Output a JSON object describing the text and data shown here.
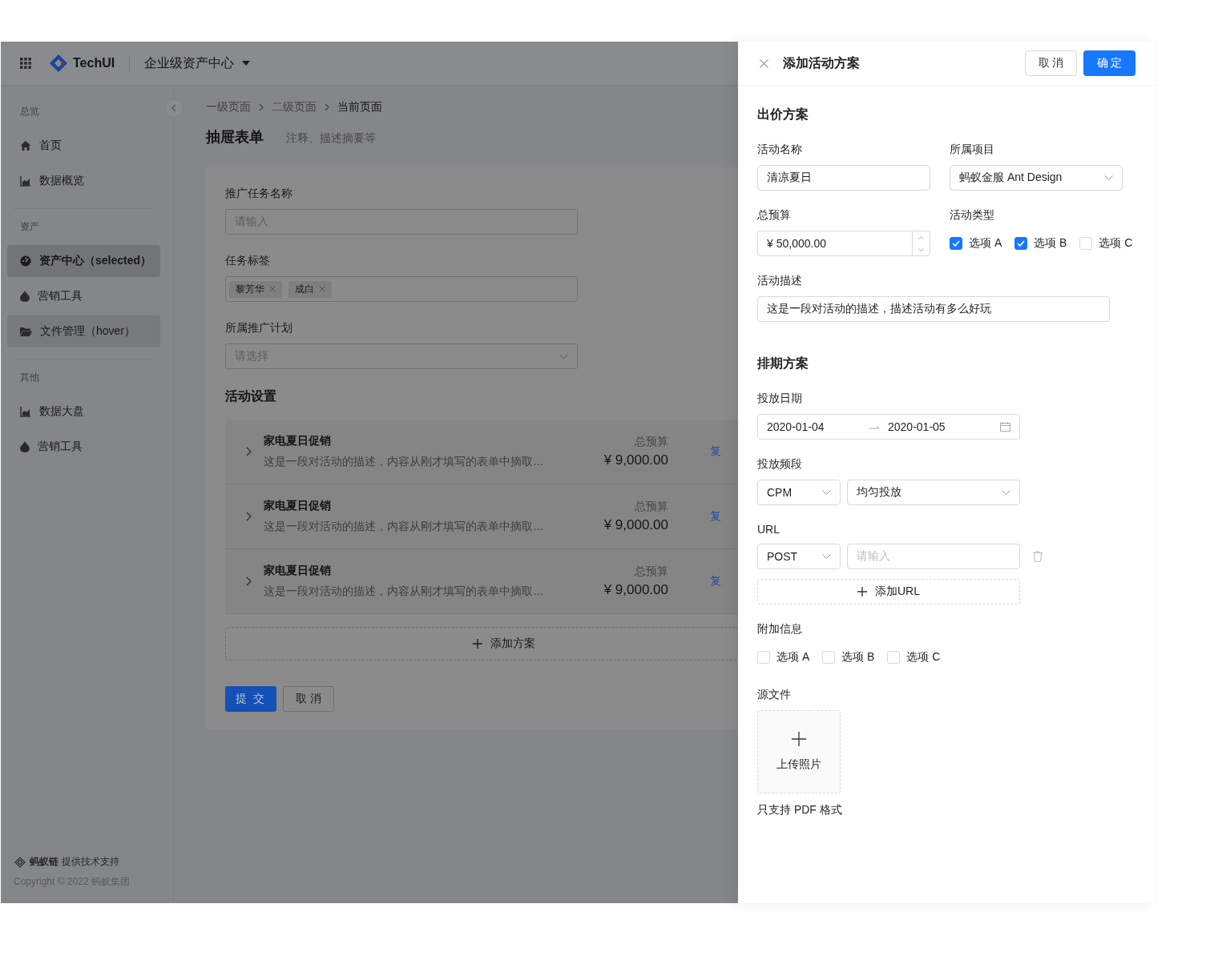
{
  "header": {
    "brand": "TechUI",
    "app_switch": "企业级资产中心"
  },
  "sidebar": {
    "groups": [
      {
        "title": "总览",
        "items": [
          {
            "label": "首页",
            "selected": false,
            "hovered": false
          },
          {
            "label": "数据概览",
            "selected": false,
            "hovered": false
          }
        ]
      },
      {
        "title": "资产",
        "items": [
          {
            "label": "资产中心（selected）",
            "selected": true,
            "hovered": false
          },
          {
            "label": "营销工具",
            "selected": false,
            "hovered": false
          },
          {
            "label": "文件管理（hover）",
            "selected": false,
            "hovered": true
          }
        ]
      },
      {
        "title": "其他",
        "items": [
          {
            "label": "数据大盘",
            "selected": false,
            "hovered": false
          },
          {
            "label": "营销工具",
            "selected": false,
            "hovered": false
          }
        ]
      }
    ],
    "footer": {
      "support_brand": "蚂蚁链",
      "support_text": "提供技术支持",
      "copyright": "Copyright © 2022 蚂蚁集团"
    }
  },
  "breadcrumb": [
    {
      "label": "一级页面",
      "current": false
    },
    {
      "label": "二级页面",
      "current": false
    },
    {
      "label": "当前页面",
      "current": true
    }
  ],
  "page": {
    "title": "抽屉表单",
    "subtitle": "注释、描述摘要等"
  },
  "form": {
    "fields": [
      {
        "kind": "input",
        "label": "推广任务名称",
        "placeholder": "请输入"
      },
      {
        "kind": "tags",
        "label": "任务标签",
        "tags": [
          "黎芳华",
          "成白"
        ]
      },
      {
        "kind": "select",
        "label": "所属推广计划",
        "placeholder": "请选择"
      }
    ],
    "section_title": "活动设置",
    "plans": [
      {
        "title": "家电夏日促销",
        "description": "这是一段对活动的描述，内容从刚才填写的表单中摘取…",
        "budget_label": "总预算",
        "budget": "¥ 9,000.00",
        "action": "复"
      },
      {
        "title": "家电夏日促销",
        "description": "这是一段对活动的描述，内容从刚才填写的表单中摘取…",
        "budget_label": "总预算",
        "budget": "¥ 9,000.00",
        "action": "复"
      },
      {
        "title": "家电夏日促销",
        "description": "这是一段对活动的描述，内容从刚才填写的表单中摘取…",
        "budget_label": "总预算",
        "budget": "¥ 9,000.00",
        "action": "复"
      }
    ],
    "add_plan": "添加方案",
    "submit": "提 交",
    "cancel": "取 消"
  },
  "drawer": {
    "title": "添加活动方案",
    "cancel": "取 消",
    "confirm": "确 定",
    "bid": {
      "title": "出价方案",
      "name": {
        "label": "活动名称",
        "value": "清凉夏日"
      },
      "project": {
        "label": "所属项目",
        "value": "蚂蚁金服 Ant Design"
      },
      "budget": {
        "label": "总预算",
        "value": "¥ 50,000.00"
      },
      "type": {
        "label": "活动类型",
        "options": [
          {
            "label": "选项 A",
            "checked": true
          },
          {
            "label": "选项 B",
            "checked": true
          },
          {
            "label": "选项 C",
            "checked": false
          }
        ]
      },
      "description": {
        "label": "活动描述",
        "value": "这是一段对活动的描述，描述活动有多么好玩"
      }
    },
    "schedule": {
      "title": "排期方案",
      "dates": {
        "label": "投放日期",
        "start": "2020-01-04",
        "end": "2020-01-05"
      },
      "frequency": {
        "label": "投放频段",
        "unit": "CPM",
        "mode": "均匀投放"
      },
      "url": {
        "label": "URL",
        "method": "POST",
        "placeholder": "请输入",
        "add": "添加URL"
      },
      "extra": {
        "label": "附加信息",
        "options": [
          {
            "label": "选项 A",
            "checked": false
          },
          {
            "label": "选项 B",
            "checked": false
          },
          {
            "label": "选项 C",
            "checked": false
          }
        ]
      },
      "source": {
        "label": "源文件",
        "upload": "上传照片",
        "hint": "只支持 PDF 格式"
      }
    }
  }
}
